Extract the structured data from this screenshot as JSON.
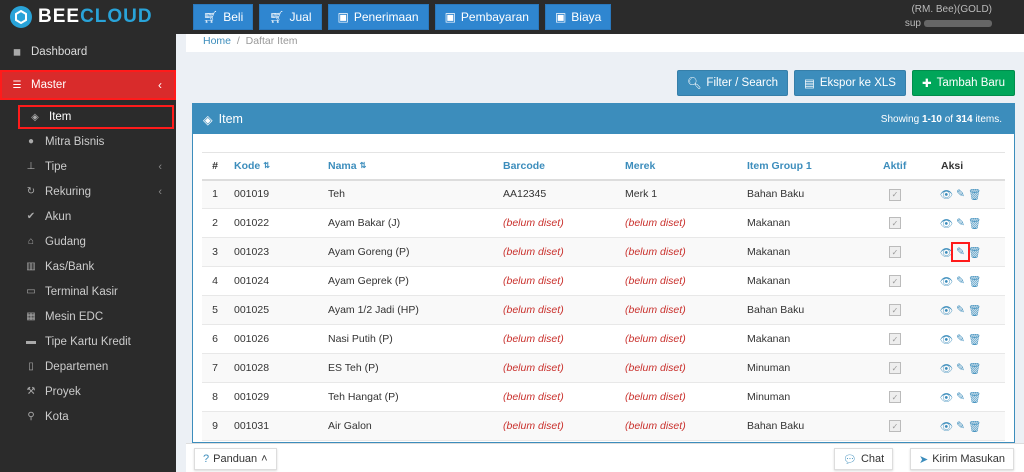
{
  "brand": {
    "name_left": "BEE",
    "name_right": "CLOUD"
  },
  "topnav": [
    {
      "label": "Beli",
      "icon": "cart-icon"
    },
    {
      "label": "Jual",
      "icon": "cart-icon"
    },
    {
      "label": "Penerimaan",
      "icon": "money-icon"
    },
    {
      "label": "Pembayaran",
      "icon": "money-icon"
    },
    {
      "label": "Biaya",
      "icon": "money-icon"
    }
  ],
  "user": {
    "company": "(RM. Bee)(GOLD)",
    "prefix": "sup"
  },
  "sidebar": {
    "dashboard": "Dashboard",
    "master": "Master",
    "items": [
      {
        "label": "Item",
        "icon": "cube-icon"
      },
      {
        "label": "Mitra Bisnis",
        "icon": "users-icon"
      },
      {
        "label": "Tipe",
        "icon": "sitemap-icon"
      },
      {
        "label": "Rekuring",
        "icon": "refresh-icon"
      },
      {
        "label": "Akun",
        "icon": "check-icon"
      },
      {
        "label": "Gudang",
        "icon": "home-icon"
      },
      {
        "label": "Kas/Bank",
        "icon": "bank-icon"
      },
      {
        "label": "Terminal Kasir",
        "icon": "monitor-icon"
      },
      {
        "label": "Mesin EDC",
        "icon": "calculator-icon"
      },
      {
        "label": "Tipe Kartu Kredit",
        "icon": "credit-card-icon"
      },
      {
        "label": "Departemen",
        "icon": "building-icon"
      },
      {
        "label": "Proyek",
        "icon": "gavel-icon"
      },
      {
        "label": "Kota",
        "icon": "map-marker-icon"
      }
    ]
  },
  "breadcrumb": {
    "home": "Home",
    "sep": "/",
    "current": "Daftar Item"
  },
  "actions": {
    "filter": "Filter / Search",
    "export": "Ekspor ke XLS",
    "add": "Tambah Baru"
  },
  "panel": {
    "title": "Item",
    "showing_prefix": "Showing ",
    "showing_range": "1-10",
    "showing_of": " of ",
    "showing_total": "314",
    "showing_suffix": " items."
  },
  "table": {
    "headers": [
      "#",
      "Kode",
      "Nama",
      "Barcode",
      "Merek",
      "Item Group 1",
      "Aktif",
      "Aksi"
    ],
    "rows": [
      [
        "1",
        "001019",
        "Teh",
        "AA12345",
        "Merk 1",
        "Bahan Baku"
      ],
      [
        "2",
        "001022",
        "Ayam Bakar (J)",
        "(belum diset)",
        "(belum diset)",
        "Makanan"
      ],
      [
        "3",
        "001023",
        "Ayam Goreng (P)",
        "(belum diset)",
        "(belum diset)",
        "Makanan"
      ],
      [
        "4",
        "001024",
        "Ayam Geprek (P)",
        "(belum diset)",
        "(belum diset)",
        "Makanan"
      ],
      [
        "5",
        "001025",
        "Ayam 1/2 Jadi (HP)",
        "(belum diset)",
        "(belum diset)",
        "Bahan Baku"
      ],
      [
        "6",
        "001026",
        "Nasi Putih (P)",
        "(belum diset)",
        "(belum diset)",
        "Makanan"
      ],
      [
        "7",
        "001028",
        "ES Teh (P)",
        "(belum diset)",
        "(belum diset)",
        "Minuman"
      ],
      [
        "8",
        "001029",
        "Teh Hangat (P)",
        "(belum diset)",
        "(belum diset)",
        "Minuman"
      ],
      [
        "9",
        "001031",
        "Air Galon",
        "(belum diset)",
        "(belum diset)",
        "Bahan Baku"
      ]
    ]
  },
  "bottom": {
    "guide": "Panduan",
    "chat": "Chat",
    "feedback": "Kirim Masukan"
  },
  "colors": {
    "accent": "#3c8dbc",
    "active_menu": "#d92b2b",
    "add_button": "#00a65a",
    "highlight": "#ff1b1b"
  }
}
